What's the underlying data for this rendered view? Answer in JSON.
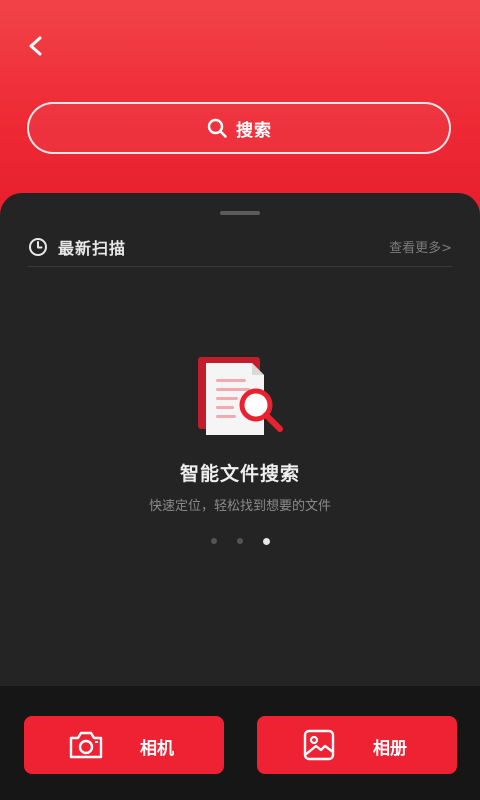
{
  "header": {
    "back_icon": "chevron-left-icon",
    "search": {
      "label": "搜索",
      "icon": "search-icon"
    }
  },
  "recent": {
    "icon": "clock-icon",
    "title": "最新扫描",
    "more_label": "查看更多>"
  },
  "empty_state": {
    "illustration": "document-search-icon",
    "title": "智能文件搜索",
    "subtitle": "快速定位，轻松找到想要的文件"
  },
  "carousel": {
    "total": 3,
    "active_index": 3
  },
  "actions": {
    "camera": {
      "label": "相机",
      "icon": "camera-icon"
    },
    "album": {
      "label": "相册",
      "icon": "photo-album-icon"
    }
  },
  "colors": {
    "accent": "#ee2233",
    "header_top": "#f24349",
    "sheet_bg": "#242424",
    "bottom_bg": "#161616"
  }
}
